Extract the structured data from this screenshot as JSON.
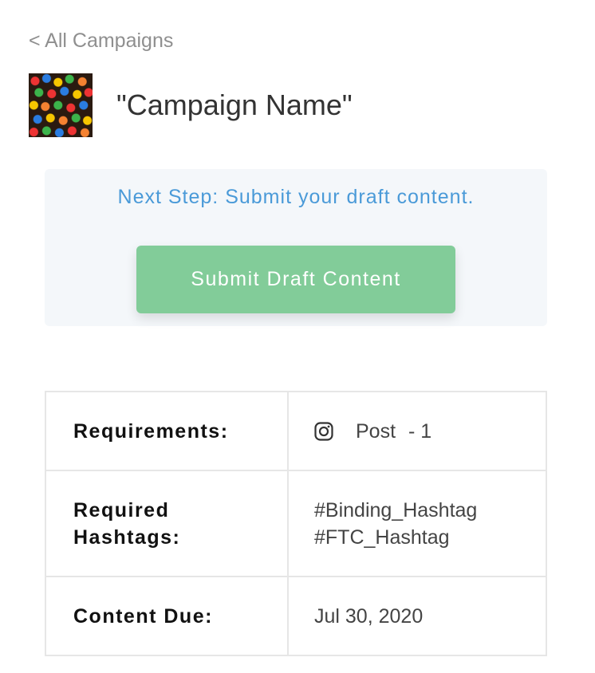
{
  "nav": {
    "back_link": "< All Campaigns"
  },
  "campaign": {
    "name": "\"Campaign Name\""
  },
  "next_step": {
    "message": "Next Step: Submit your draft content.",
    "button_label": "Submit Draft Content"
  },
  "requirements": {
    "rows": [
      {
        "label": "Requirements:",
        "platform_icon": "instagram-icon",
        "content_type": "Post",
        "count": "- 1"
      },
      {
        "label_line1": "Required",
        "label_line2": "Hashtags:",
        "hashtags": [
          "#Binding_Hashtag",
          "#FTC_Hashtag"
        ]
      },
      {
        "label": "Content Due:",
        "value": "Jul 30, 2020"
      }
    ]
  },
  "colors": {
    "accent_blue": "#4a9ad8",
    "button_green": "#82cc99",
    "panel_bg": "#f4f7fa",
    "border": "#e6e6e6"
  }
}
